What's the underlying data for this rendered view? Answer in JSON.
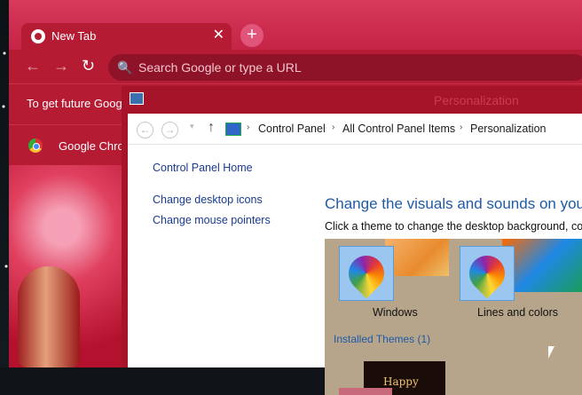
{
  "browser": {
    "tab": {
      "title": "New Tab",
      "close_glyph": "✕"
    },
    "new_tab_glyph": "+",
    "nav": {
      "back_glyph": "←",
      "forward_glyph": "→",
      "reload_glyph": "↻"
    },
    "omnibox": {
      "placeholder": "Search Google or type a URL",
      "search_glyph": "🔍"
    },
    "infobar": {
      "text": "To get future Goog"
    },
    "bookmark": {
      "label": "Google Chro"
    }
  },
  "control_panel": {
    "window_title": "Personalization",
    "address": {
      "back_glyph": "←",
      "forward_glyph": "→",
      "dropdown_glyph": "▾",
      "up_glyph": "↑",
      "separator": "›",
      "crumbs": [
        "Control Panel",
        "All Control Panel Items",
        "Personalization"
      ]
    },
    "sidebar": {
      "home": "Control Panel Home",
      "links": [
        "Change desktop icons",
        "Change mouse pointers"
      ]
    },
    "main": {
      "heading": "Change the visuals and sounds on your co",
      "subtext": "Click a theme to change the desktop background, colo",
      "themes": [
        {
          "label": "Windows"
        },
        {
          "label": "Lines and colors"
        }
      ],
      "installed_heading": "Installed Themes (1)",
      "installed_thumb_text": "Happy"
    }
  }
}
